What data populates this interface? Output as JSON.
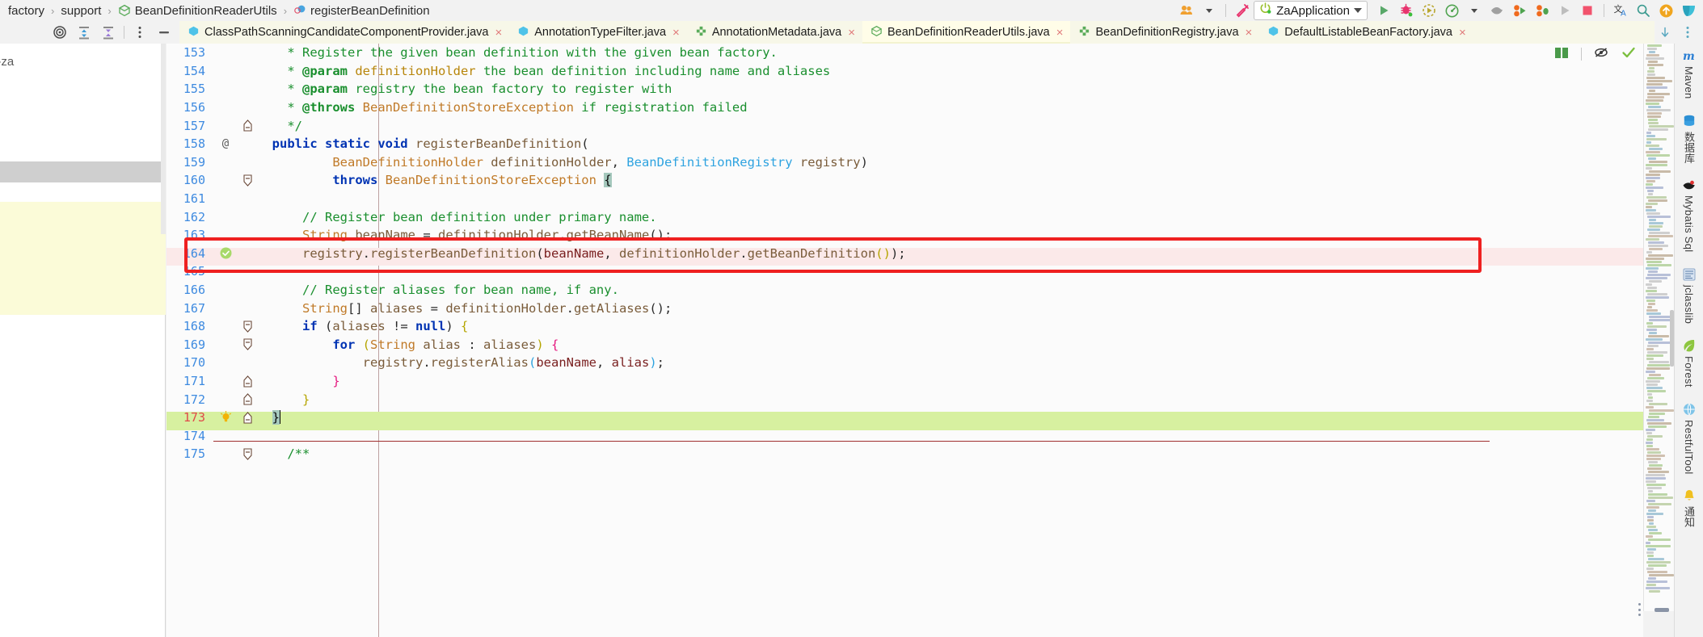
{
  "breadcrumb": {
    "items": [
      {
        "label": "factory",
        "icon": "none"
      },
      {
        "label": "support",
        "icon": "none"
      },
      {
        "label": "BeanDefinitionReaderUtils",
        "icon": "class-icon"
      },
      {
        "label": "registerBeanDefinition",
        "icon": "method-icon"
      }
    ],
    "separator": "›"
  },
  "toolbar": {
    "profile_icon": "users-icon",
    "profile_caret": "chevron-down-icon",
    "build_icon": "hammer-icon",
    "run_config": {
      "label": "ZaApplication",
      "status_icon": "power-run-icon",
      "caret": "chevron-down-icon"
    },
    "actions": [
      {
        "name": "run-button",
        "icon": "play-icon"
      },
      {
        "name": "debug-button",
        "icon": "bug-icon"
      },
      {
        "name": "run-with-coverage-button",
        "icon": "coverage-icon"
      },
      {
        "name": "profiler-button",
        "icon": "gauge-icon"
      },
      {
        "name": "profiler-caret",
        "icon": "chevron-down-icon"
      },
      {
        "name": "attach-debugger-button",
        "icon": "bird-icon"
      },
      {
        "name": "run-dashboard-button",
        "icon": "run-multi-icon"
      },
      {
        "name": "debug-dashboard-button",
        "icon": "debug-multi-icon"
      },
      {
        "name": "rerun-button",
        "icon": "play-disabled-icon"
      },
      {
        "name": "stop-button",
        "icon": "stop-square-icon"
      },
      {
        "name": "translate-button",
        "icon": "translate-icon"
      },
      {
        "name": "search-everywhere-button",
        "icon": "search-icon"
      },
      {
        "name": "update-project-button",
        "icon": "arrow-up-circle-icon"
      },
      {
        "name": "send-button",
        "icon": "send-icon"
      }
    ]
  },
  "left_tool_strip": {
    "actions": [
      {
        "name": "locate-button",
        "icon": "target-icon"
      },
      {
        "name": "expand-all-button",
        "icon": "expand-all-icon"
      },
      {
        "name": "collapse-all-button",
        "icon": "collapse-all-icon"
      },
      {
        "name": "options-button",
        "icon": "more-vertical-icon"
      },
      {
        "name": "hide-button",
        "icon": "minus-icon"
      }
    ]
  },
  "left_panel": {
    "truncated_label": "g-za"
  },
  "tabs": [
    {
      "label": "ClassPathScanningCandidateComponentProvider.java",
      "icon": "class-icon-blue",
      "active": false,
      "close": "×"
    },
    {
      "label": "AnnotationTypeFilter.java",
      "icon": "class-icon-blue",
      "active": false,
      "close": "×"
    },
    {
      "label": "AnnotationMetadata.java",
      "icon": "interface-icon-green",
      "active": false,
      "close": "×"
    },
    {
      "label": "BeanDefinitionReaderUtils.java",
      "icon": "class-icon-green",
      "active": true,
      "close": "×"
    },
    {
      "label": "BeanDefinitionRegistry.java",
      "icon": "interface-icon-green",
      "active": false,
      "close": "×"
    },
    {
      "label": "DefaultListableBeanFactory.java",
      "icon": "class-icon-blue",
      "active": false,
      "close": "×"
    }
  ],
  "tabs_end_actions": [
    {
      "name": "scroll-down-icon",
      "icon": "arrow-down-icon"
    },
    {
      "name": "tab-options-icon",
      "icon": "more-vertical-icon"
    }
  ],
  "editor_header_actions": [
    {
      "name": "reader-mode-icon",
      "icon": "book-icon"
    },
    {
      "name": "hide-inspections-icon",
      "icon": "eye-off-icon"
    },
    {
      "name": "inspections-ok-icon",
      "icon": "check-icon"
    }
  ],
  "code": {
    "first_line": 153,
    "current_line": 173,
    "lines": [
      {
        "n": 153,
        "fold": "",
        "mark": "",
        "clipped": true,
        "tokens": [
          {
            "t": "    * Register the given bean definition with the given bean factory.",
            "c": "jdoc"
          }
        ]
      },
      {
        "n": 154,
        "fold": "",
        "mark": "",
        "tokens": [
          {
            "t": "    * ",
            "c": "jdoc"
          },
          {
            "t": "@param",
            "c": "tag"
          },
          {
            "t": " definitionHolder",
            "c": "typ"
          },
          {
            "t": " the bean definition including name and aliases",
            "c": "jdoc"
          }
        ]
      },
      {
        "n": 155,
        "fold": "",
        "mark": "",
        "tokens": [
          {
            "t": "    * ",
            "c": "jdoc"
          },
          {
            "t": "@param",
            "c": "tag"
          },
          {
            "t": " registry",
            "c": "jdoc"
          },
          {
            "t": " the bean factory to register with",
            "c": "jdoc"
          }
        ]
      },
      {
        "n": 156,
        "fold": "",
        "mark": "",
        "tokens": [
          {
            "t": "    * ",
            "c": "jdoc"
          },
          {
            "t": "@throws",
            "c": "tag"
          },
          {
            "t": " BeanDefinitionStoreException",
            "c": "cls"
          },
          {
            "t": " if registration failed",
            "c": "jdoc"
          }
        ]
      },
      {
        "n": 157,
        "fold": "fold-end-up",
        "mark": "",
        "tokens": [
          {
            "t": "    */",
            "c": "jdoc"
          }
        ]
      },
      {
        "n": 158,
        "fold": "",
        "mark": "@",
        "tokens": [
          {
            "t": "  ",
            "c": "pun"
          },
          {
            "t": "public static void ",
            "c": "kw"
          },
          {
            "t": "registerBeanDefinition",
            "c": "fn"
          },
          {
            "t": "(",
            "c": "pun"
          }
        ]
      },
      {
        "n": 159,
        "fold": "",
        "mark": "",
        "tokens": [
          {
            "t": "          ",
            "c": "pun"
          },
          {
            "t": "BeanDefinitionHolder",
            "c": "cls"
          },
          {
            "t": " definitionHolder",
            "c": "fn"
          },
          {
            "t": ", ",
            "c": "pun"
          },
          {
            "t": "BeanDefinitionRegistry",
            "c": "blue"
          },
          {
            "t": " registry",
            "c": "fn"
          },
          {
            "t": ")",
            "c": "pun"
          }
        ]
      },
      {
        "n": 160,
        "fold": "fold-down",
        "mark": "",
        "tokens": [
          {
            "t": "          ",
            "c": "pun"
          },
          {
            "t": "throws ",
            "c": "kw"
          },
          {
            "t": "BeanDefinitionStoreException",
            "c": "cls"
          },
          {
            "t": " ",
            "c": "pun"
          },
          {
            "t": "{",
            "c": "sel"
          }
        ]
      },
      {
        "n": 161,
        "fold": "",
        "mark": "",
        "tokens": []
      },
      {
        "n": 162,
        "fold": "",
        "mark": "",
        "tokens": [
          {
            "t": "      // Register bean definition under primary name.",
            "c": "cmt"
          }
        ]
      },
      {
        "n": 163,
        "fold": "",
        "mark": "",
        "tokens": [
          {
            "t": "      ",
            "c": "pun"
          },
          {
            "t": "String",
            "c": "cls"
          },
          {
            "t": " beanName ",
            "c": "fn"
          },
          {
            "t": "= ",
            "c": "pun"
          },
          {
            "t": "definitionHolder",
            "c": "fn"
          },
          {
            "t": ".",
            "c": "pun"
          },
          {
            "t": "getBeanName",
            "c": "fn"
          },
          {
            "t": "();",
            "c": "pun"
          }
        ]
      },
      {
        "n": 164,
        "fold": "",
        "mark": "check",
        "highlighted": true,
        "tokens": [
          {
            "t": "      ",
            "c": "pun"
          },
          {
            "t": "registry",
            "c": "fn"
          },
          {
            "t": ".",
            "c": "pun"
          },
          {
            "t": "registerBeanDefinition",
            "c": "fn"
          },
          {
            "t": "(",
            "c": "pun"
          },
          {
            "t": "beanName",
            "c": "par"
          },
          {
            "t": ", ",
            "c": "pun"
          },
          {
            "t": "definitionHolder",
            "c": "fn"
          },
          {
            "t": ".",
            "c": "pun"
          },
          {
            "t": "getBeanDefinition",
            "c": "fn"
          },
          {
            "t": "()",
            "c": "yel"
          },
          {
            "t": ");",
            "c": "pun"
          }
        ]
      },
      {
        "n": 165,
        "fold": "",
        "mark": "",
        "tokens": []
      },
      {
        "n": 166,
        "fold": "",
        "mark": "",
        "tokens": [
          {
            "t": "      // Register aliases for bean name, if any.",
            "c": "cmt"
          }
        ]
      },
      {
        "n": 167,
        "fold": "",
        "mark": "",
        "tokens": [
          {
            "t": "      ",
            "c": "pun"
          },
          {
            "t": "String",
            "c": "cls"
          },
          {
            "t": "[] ",
            "c": "pun"
          },
          {
            "t": "aliases ",
            "c": "fn"
          },
          {
            "t": "= ",
            "c": "pun"
          },
          {
            "t": "definitionHolder",
            "c": "fn"
          },
          {
            "t": ".",
            "c": "pun"
          },
          {
            "t": "getAliases",
            "c": "fn"
          },
          {
            "t": "();",
            "c": "pun"
          }
        ]
      },
      {
        "n": 168,
        "fold": "fold-down",
        "mark": "",
        "tokens": [
          {
            "t": "      ",
            "c": "pun"
          },
          {
            "t": "if ",
            "c": "kw"
          },
          {
            "t": "(",
            "c": "pun"
          },
          {
            "t": "aliases ",
            "c": "fn"
          },
          {
            "t": "!= ",
            "c": "pun"
          },
          {
            "t": "null",
            "c": "kw"
          },
          {
            "t": ") ",
            "c": "pun"
          },
          {
            "t": "{",
            "c": "yel"
          }
        ]
      },
      {
        "n": 169,
        "fold": "fold-down",
        "mark": "",
        "tokens": [
          {
            "t": "          ",
            "c": "pun"
          },
          {
            "t": "for ",
            "c": "kw"
          },
          {
            "t": "(",
            "c": "yel"
          },
          {
            "t": "String",
            "c": "cls"
          },
          {
            "t": " alias ",
            "c": "fn"
          },
          {
            "t": ": ",
            "c": "pun"
          },
          {
            "t": "aliases",
            "c": "fn"
          },
          {
            "t": ") ",
            "c": "yel"
          },
          {
            "t": "{",
            "c": "mag"
          }
        ]
      },
      {
        "n": 170,
        "fold": "",
        "mark": "",
        "tokens": [
          {
            "t": "              ",
            "c": "pun"
          },
          {
            "t": "registry",
            "c": "fn"
          },
          {
            "t": ".",
            "c": "pun"
          },
          {
            "t": "registerAlias",
            "c": "fn"
          },
          {
            "t": "(",
            "c": "blue"
          },
          {
            "t": "beanName",
            "c": "par"
          },
          {
            "t": ", ",
            "c": "pun"
          },
          {
            "t": "alias",
            "c": "par"
          },
          {
            "t": ")",
            "c": "blue"
          },
          {
            "t": ";",
            "c": "pun"
          }
        ]
      },
      {
        "n": 171,
        "fold": "fold-end-up",
        "mark": "",
        "tokens": [
          {
            "t": "          ",
            "c": "pun"
          },
          {
            "t": "}",
            "c": "mag"
          }
        ]
      },
      {
        "n": 172,
        "fold": "fold-end-up",
        "mark": "",
        "tokens": [
          {
            "t": "      ",
            "c": "pun"
          },
          {
            "t": "}",
            "c": "yel"
          }
        ]
      },
      {
        "n": 173,
        "fold": "fold-end-up",
        "mark": "bulb",
        "current": true,
        "tokens": [
          {
            "t": "  ",
            "c": "pun"
          },
          {
            "t": "}",
            "c": "sel"
          }
        ]
      },
      {
        "n": 174,
        "fold": "",
        "mark": "",
        "tokens": []
      },
      {
        "n": 175,
        "fold": "fold-down",
        "mark": "",
        "tokens": [
          {
            "t": "    /**",
            "c": "jdoc"
          }
        ]
      }
    ]
  },
  "annotation": {
    "type": "red-rectangle",
    "target_line": 164,
    "color": "#ef2020"
  },
  "right_sidebar": {
    "items": [
      {
        "label": "Maven",
        "icon": "maven-m-icon"
      },
      {
        "label": "数据库",
        "icon": "database-icon"
      },
      {
        "label": "Mybatis Sql",
        "icon": "mybatis-bird-icon"
      },
      {
        "label": "jclasslib",
        "icon": "jclasslib-icon"
      },
      {
        "label": "Forest",
        "icon": "forest-leaf-icon"
      },
      {
        "label": "RestfulTool",
        "icon": "globe-icon"
      },
      {
        "label": "通知",
        "icon": "bell-icon"
      }
    ]
  },
  "colors": {
    "accent_red": "#ef2020",
    "tab_active_bg": "#fffde8",
    "current_line_bg": "#d7f0a0",
    "highlight_row_bg": "#fbe9e9",
    "line_number": "#3d8ae0",
    "current_line_number": "#e04a4a"
  }
}
